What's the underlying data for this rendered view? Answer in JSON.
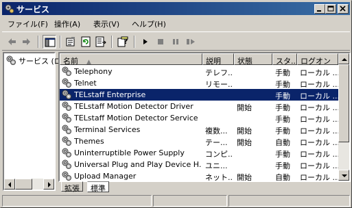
{
  "window": {
    "title": "サービス",
    "controls": [
      "minimize",
      "maximize",
      "close"
    ]
  },
  "menu": [
    "ファイル(F)",
    "操作(A)",
    "表示(V)",
    "ヘルプ(H)"
  ],
  "toolbar": {
    "buttons": [
      "back-icon",
      "forward-icon",
      "show-hide-tree-icon",
      "properties-icon",
      "refresh-icon",
      "export-list-icon",
      "help-icon",
      "start-icon",
      "stop-icon",
      "pause-icon",
      "restart-icon"
    ]
  },
  "tree": {
    "root_label": "サービス (ロ"
  },
  "list": {
    "columns": [
      "名前",
      "説明",
      "状態",
      "スタ...",
      "ログオン"
    ],
    "sort_indicator": "▲",
    "selected_index": 2,
    "rows": [
      {
        "name": "Telephony",
        "desc": "テレフ...",
        "status": "",
        "startup": "手動",
        "logon": "ローカル ..."
      },
      {
        "name": "Telnet",
        "desc": "リモー...",
        "status": "",
        "startup": "手動",
        "logon": "ローカル ..."
      },
      {
        "name": "TELstaff Enterprise",
        "desc": "",
        "status": "",
        "startup": "手動",
        "logon": "ローカル ..."
      },
      {
        "name": "TELstaff Motion Detector Driver",
        "desc": "",
        "status": "開始",
        "startup": "手動",
        "logon": "ローカル ..."
      },
      {
        "name": "TELstaff Motion Detector Service",
        "desc": "",
        "status": "",
        "startup": "手動",
        "logon": "ローカル ..."
      },
      {
        "name": "Terminal Services",
        "desc": "複数...",
        "status": "開始",
        "startup": "手動",
        "logon": "ローカル ..."
      },
      {
        "name": "Themes",
        "desc": "テー...",
        "status": "開始",
        "startup": "自動",
        "logon": "ローカル ..."
      },
      {
        "name": "Uninterruptible Power Supply",
        "desc": "コンピ...",
        "status": "",
        "startup": "手動",
        "logon": "ローカル ..."
      },
      {
        "name": "Universal Plug and Play Device H...",
        "desc": "ユニ...",
        "status": "",
        "startup": "手動",
        "logon": "ローカル ..."
      },
      {
        "name": "Upload Manager",
        "desc": "ネット...",
        "status": "開始",
        "startup": "自動",
        "logon": "ローカル ..."
      }
    ]
  },
  "tabs": [
    "拡張",
    "標準"
  ],
  "active_tab": 1,
  "colors": {
    "title_start": "#0a246a",
    "title_end": "#3a6ea5",
    "selection": "#0a246a",
    "face": "#d4d0c8"
  }
}
